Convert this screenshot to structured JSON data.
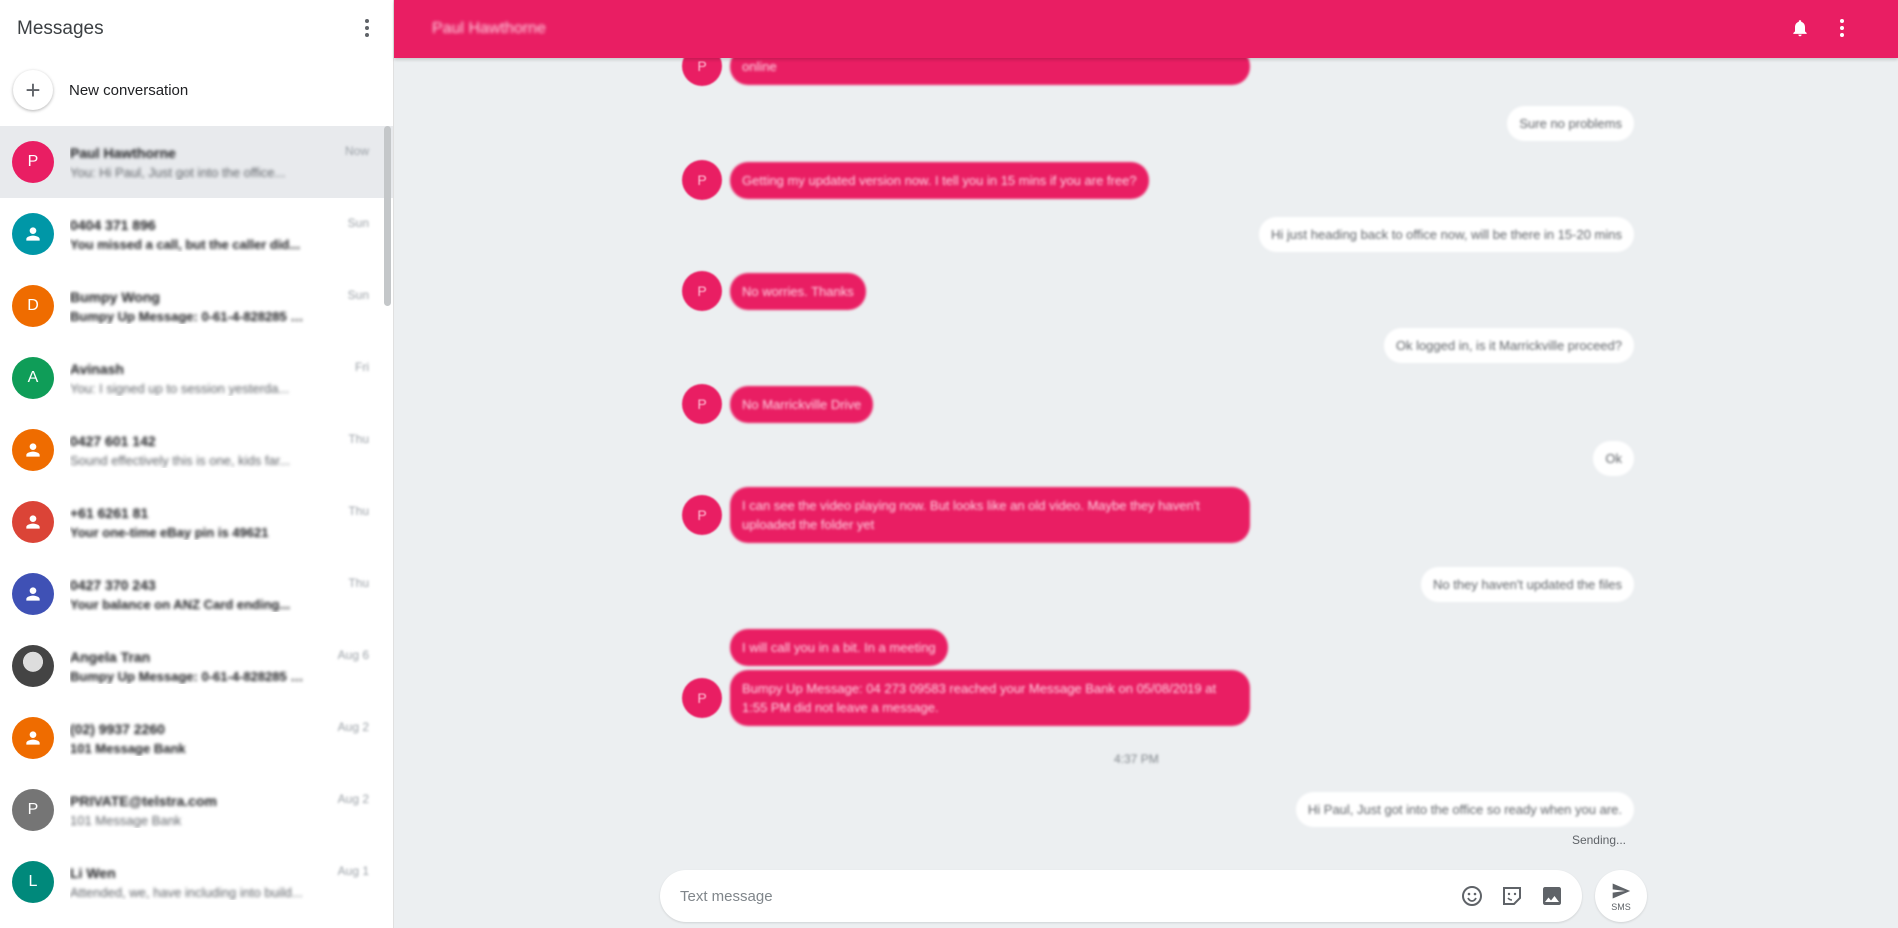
{
  "sidebar": {
    "title": "Messages",
    "menu_icon": "more-vert-icon",
    "new_conversation_label": "New conversation",
    "conversations": [
      {
        "avatar": "P",
        "color": "#e91e63",
        "name": "Paul Hawthorne",
        "snippet": "You: Hi Paul, Just got into the office...",
        "time": "Now",
        "selected": true,
        "dark": false
      },
      {
        "avatar": "person",
        "color": "#0097a7",
        "name": "0404 371 896",
        "snippet": "You missed a call, but the caller did...",
        "time": "Sun",
        "selected": false,
        "dark": true
      },
      {
        "avatar": "D",
        "color": "#ef6c00",
        "name": "Bumpy Wong",
        "snippet": "Bumpy Up Message: 0-61-4-828285 ma...",
        "time": "Sun",
        "selected": false,
        "dark": true
      },
      {
        "avatar": "A",
        "color": "#0f9d58",
        "name": "Avinash",
        "snippet": "You: I signed up to session yesterda...",
        "time": "Fri",
        "selected": false,
        "dark": false
      },
      {
        "avatar": "person",
        "color": "#ef6c00",
        "name": "0427 601 142",
        "snippet": "Sound effectively this is one, kids far...",
        "time": "Thu",
        "selected": false,
        "dark": false
      },
      {
        "avatar": "person",
        "color": "#db4437",
        "name": "+61 6261 81",
        "snippet": "Your one-time eBay pin is 49621",
        "time": "Thu",
        "selected": false,
        "dark": true
      },
      {
        "avatar": "person",
        "color": "#3f51b5",
        "name": "0427 370 243",
        "snippet": "Your balance on ANZ Card ending...",
        "time": "Thu",
        "selected": false,
        "dark": true
      },
      {
        "avatar": "img",
        "color": "#444444",
        "name": "Angela Tran",
        "snippet": "Bumpy Up Message: 0-61-4-828285 ma...",
        "time": "Aug 6",
        "selected": false,
        "dark": true
      },
      {
        "avatar": "person",
        "color": "#ef6c00",
        "name": "(02) 9937 2260",
        "snippet": "101 Message Bank",
        "time": "Aug 2",
        "selected": false,
        "dark": true
      },
      {
        "avatar": "P",
        "color": "#757575",
        "name": "PRIVATE@telstra.com",
        "snippet": "101 Message Bank",
        "time": "Aug 2",
        "selected": false,
        "dark": false
      },
      {
        "avatar": "L",
        "color": "#00897b",
        "name": "Li Wen",
        "snippet": "Attended, we, have including into build...",
        "time": "Aug 1",
        "selected": false,
        "dark": false
      }
    ]
  },
  "header": {
    "contact_name": "Paul Hawthorne",
    "bell_icon": "notifications-bell-icon",
    "menu_icon": "more-vert-icon"
  },
  "thread": {
    "avatar_letter": "P",
    "messages": [
      {
        "dir": "in",
        "text": "online"
      },
      {
        "dir": "out",
        "text": "Sure no problems"
      },
      {
        "dir": "in",
        "text": "Getting my updated version now. I tell you in 15 mins if you are free?"
      },
      {
        "dir": "out",
        "text": "Hi just heading back to office now, will be there in 15-20 mins"
      },
      {
        "dir": "in",
        "text": "No worries. Thanks"
      },
      {
        "dir": "out",
        "text": "Ok logged in, is it Marrickville proceed?"
      },
      {
        "dir": "in",
        "text": "No Marrickville Drive"
      },
      {
        "dir": "out",
        "text": "Ok"
      },
      {
        "dir": "in",
        "text": "I can see the video playing now. But looks like an old video. Maybe they haven't uploaded the folder yet"
      },
      {
        "dir": "out",
        "text": "No they haven't updated the files"
      },
      {
        "dir": "in",
        "text": "I will call you in a bit. In a meeting"
      },
      {
        "dir": "in",
        "text": "Bumpy Up Message: 04 273 09583 reached your Message Bank on 05/08/2019 at 1:55 PM did not leave a message."
      },
      {
        "dir": "timestamp",
        "text": "4:37 PM"
      },
      {
        "dir": "out",
        "text": "Hi Paul, Just got into the office so ready when you are."
      }
    ],
    "sending_label": "Sending..."
  },
  "composer": {
    "placeholder": "Text message",
    "emoji_icon": "emoji-smile-icon",
    "sticker_icon": "sticker-icon",
    "image_icon": "image-icon",
    "send_icon": "send-icon",
    "send_sub_label": "SMS"
  },
  "colors": {
    "accent": "#e91e63",
    "background": "#eceff1"
  }
}
